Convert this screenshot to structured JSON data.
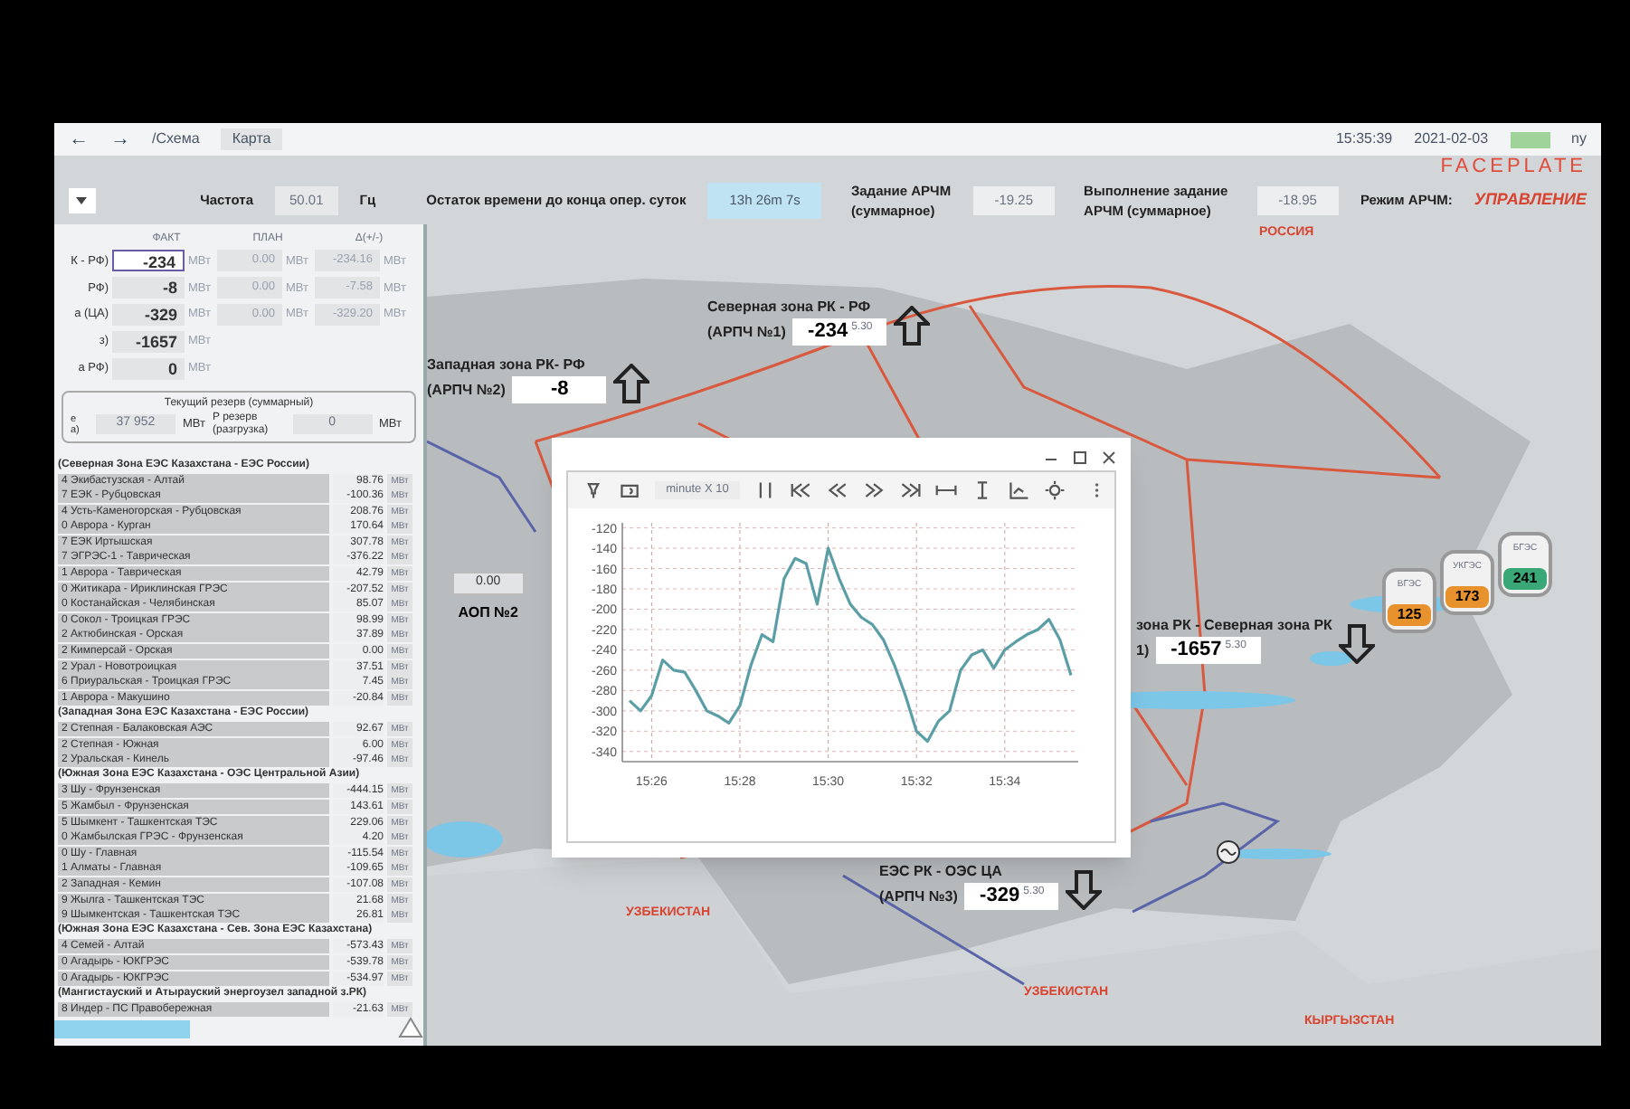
{
  "nav": {
    "back": "←",
    "forward": "→",
    "path": "/Схема",
    "tab": "Карта",
    "time": "15:35:39",
    "date": "2021-02-03",
    "user": "ny"
  },
  "logo": "FACEPLATE",
  "params": {
    "freq_label": "Частота",
    "freq": "50.01",
    "freq_unit": "Гц",
    "remain_label": "Остаток времени до конца опер. суток",
    "remain": "13h 26m 7s",
    "task_label": "Задание АРЧМ (суммарное)",
    "task": "-19.25",
    "exec_label": "Выполнение задание АРЧМ (суммарное)",
    "exec": "-18.95",
    "mode_label": "Режим АРЧМ:",
    "mode": "УПРАВЛЕНИЕ"
  },
  "summary": {
    "columns": [
      "ФАКТ",
      "ПЛАН",
      "Δ(+/-)"
    ],
    "rows": [
      {
        "label": "К - РФ)",
        "fact": "-234",
        "unit": "МВт",
        "plan": "0.00",
        "plan_unit": "МВт",
        "delta": "-234.16",
        "delta_unit": "МВт",
        "selected": true
      },
      {
        "label": "РФ)",
        "fact": "-8",
        "unit": "МВт",
        "plan": "0.00",
        "plan_unit": "МВт",
        "delta": "-7.58",
        "delta_unit": "МВт",
        "selected": false
      },
      {
        "label": "а (ЦА)",
        "fact": "-329",
        "unit": "МВт",
        "plan": "0.00",
        "plan_unit": "МВт",
        "delta": "-329.20",
        "delta_unit": "МВт",
        "selected": false
      },
      {
        "label": "з)",
        "fact": "-1657",
        "unit": "МВт",
        "selected": false
      },
      {
        "label": "а РФ)",
        "fact": "0",
        "unit": "МВт",
        "selected": false
      }
    ]
  },
  "reserve": {
    "title": "Текущий резерв (суммарный)",
    "label_1": "е\nа)",
    "value_1": "37 952",
    "unit_1": "МВт",
    "label_2": "P резерв (разгрузка)",
    "value_2": "0",
    "unit_2": "МВт"
  },
  "flows": [
    {
      "kind": "header",
      "name": "(Северная Зона ЕЭС Казахстана - ЕЭС России)"
    },
    {
      "kind": "row",
      "name": "4 Экибастузская - Алтай",
      "value": "98.76",
      "unit": "МВт"
    },
    {
      "kind": "row",
      "name": "7 ЕЭК - Рубцовская",
      "value": "-100.36",
      "unit": "МВт"
    },
    {
      "kind": "row",
      "name": "4 Усть-Каменогорская - Рубцовская",
      "value": "208.76",
      "unit": "МВт"
    },
    {
      "kind": "row",
      "name": "0 Аврора - Курган",
      "value": "170.64",
      "unit": "МВт"
    },
    {
      "kind": "row",
      "name": "7 ЕЭК Иртышская",
      "value": "307.78",
      "unit": "МВт"
    },
    {
      "kind": "row",
      "name": "7 ЭГРЭС-1 - Таврическая",
      "value": "-376.22",
      "unit": "МВт"
    },
    {
      "kind": "row",
      "name": "1 Аврора - Таврическая",
      "value": "42.79",
      "unit": "МВт"
    },
    {
      "kind": "row",
      "name": "0 Житикара - Ириклинская ГРЭС",
      "value": "-207.52",
      "unit": "МВт"
    },
    {
      "kind": "row",
      "name": "0 Костанайская - Челябинская",
      "value": "85.07",
      "unit": "МВт"
    },
    {
      "kind": "row",
      "name": "0 Сокол - Троицкая ГРЭС",
      "value": "98.99",
      "unit": "МВт"
    },
    {
      "kind": "row",
      "name": "2 Актюбинская - Орская",
      "value": "37.89",
      "unit": "МВт"
    },
    {
      "kind": "row",
      "name": "2 Кимперсай - Орская",
      "value": "0.00",
      "unit": "МВт"
    },
    {
      "kind": "row",
      "name": "2 Урал - Новотроицкая",
      "value": "37.51",
      "unit": "МВт"
    },
    {
      "kind": "row",
      "name": "6 Приуральская - Троицкая ГРЭС",
      "value": "7.45",
      "unit": "МВт"
    },
    {
      "kind": "row",
      "name": "1 Аврора - Макушино",
      "value": "-20.84",
      "unit": "МВт"
    },
    {
      "kind": "header",
      "name": "(Западная Зона ЕЭС Казахстана - ЕЭС России)"
    },
    {
      "kind": "row",
      "name": "2 Степная - Балаковская АЭС",
      "value": "92.67",
      "unit": "МВт"
    },
    {
      "kind": "row",
      "name": "2 Степная - Южная",
      "value": "6.00",
      "unit": "МВт"
    },
    {
      "kind": "row",
      "name": "2 Уральская - Кинель",
      "value": "-97.46",
      "unit": "МВт"
    },
    {
      "kind": "header",
      "name": "(Южная Зона ЕЭС Казахстана - ОЭС Центральной Азии)"
    },
    {
      "kind": "row",
      "name": "3 Шу - Фрунзенская",
      "value": "-444.15",
      "unit": "МВт"
    },
    {
      "kind": "row",
      "name": "5 Жамбыл - Фрунзенская",
      "value": "143.61",
      "unit": "МВт"
    },
    {
      "kind": "row",
      "name": "5 Шымкент - Ташкентская ТЭС",
      "value": "229.06",
      "unit": "МВт"
    },
    {
      "kind": "row",
      "name": "0 Жамбылская ГРЭС - Фрунзенская",
      "value": "4.20",
      "unit": "МВт"
    },
    {
      "kind": "row",
      "name": "0 Шу - Главная",
      "value": "-115.54",
      "unit": "МВт"
    },
    {
      "kind": "row",
      "name": "1 Алматы - Главная",
      "value": "-109.65",
      "unit": "МВт"
    },
    {
      "kind": "row",
      "name": "2 Западная - Кемин",
      "value": "-107.08",
      "unit": "МВт"
    },
    {
      "kind": "row",
      "name": "9 Жылга - Ташкентская ТЭС",
      "value": "21.68",
      "unit": "МВт"
    },
    {
      "kind": "row",
      "name": "9 Шымкентская - Ташкентская ТЭС",
      "value": "26.81",
      "unit": "МВт"
    },
    {
      "kind": "header",
      "name": "(Южная Зона ЕЭС Казахстана - Сев. Зона ЕЭС Казахстана)"
    },
    {
      "kind": "row",
      "name": "4 Семей - Алтай",
      "value": "-573.43",
      "unit": "МВт"
    },
    {
      "kind": "row",
      "name": "0 Агадырь - ЮКГРЭС",
      "value": "-539.78",
      "unit": "МВт"
    },
    {
      "kind": "row",
      "name": "0 Агадырь - ЮКГРЭС",
      "value": "-534.97",
      "unit": "МВт"
    },
    {
      "kind": "header",
      "name": "(Мангистауский и Атырауский энергоузел западной з.РК)"
    },
    {
      "kind": "row",
      "name": "8 Индер - ПС Правобережная",
      "value": "-21.63",
      "unit": "МВт"
    }
  ],
  "map": {
    "countries": [
      {
        "name": "РОССИЯ"
      },
      {
        "name": "УЗБЕКИСТАН"
      },
      {
        "name": "УЗБЕКИСТАН"
      },
      {
        "name": "КЫРГЫЗСТАН"
      }
    ],
    "zones": [
      {
        "title": "Северная зона РК - РФ",
        "sub": "(АРПЧ №1)",
        "value": "-234",
        "sup": "5.30",
        "arrow_up": true
      },
      {
        "title": "Западная зона РК- РФ",
        "sub": "(АРПЧ №2)",
        "value": "-8",
        "arrow_up": true
      },
      {
        "title": "зона РК - Северная зона РК",
        "sub": "1)",
        "value": "-1657",
        "sup": "5.30",
        "arrow_up": false
      },
      {
        "title": "ЕЭС РК - ОЭС ЦА",
        "sub": "(АРПЧ №3)",
        "value": "-329",
        "sup": "5.30",
        "arrow_up": false
      }
    ],
    "aop": {
      "value": "0.00",
      "label": "АОП №2"
    },
    "stations": [
      {
        "name": "ВГЭС",
        "value": "125",
        "color": "#e8922e"
      },
      {
        "name": "УКГЭС",
        "value": "173",
        "color": "#e8922e"
      },
      {
        "name": "БГЭС",
        "value": "241",
        "color": "#3aa876"
      }
    ]
  },
  "chart_window": {
    "scale": "minute X 10",
    "chart_data": {
      "type": "line",
      "categories": [
        null,
        null,
        "15:26",
        null,
        null,
        null,
        null,
        null,
        null,
        null,
        "15:28",
        null,
        null,
        null,
        null,
        null,
        null,
        null,
        "15:30",
        null,
        null,
        null,
        null,
        null,
        null,
        null,
        "15:32",
        null,
        null,
        null,
        null,
        null,
        null,
        null,
        "15:34",
        null,
        null,
        null,
        null,
        null,
        null
      ],
      "series": [
        {
          "color": "#5b9ea6",
          "values": [
            -290,
            -300,
            -285,
            -250,
            -260,
            -262,
            -280,
            -300,
            -305,
            -312,
            -295,
            -255,
            -225,
            -232,
            -170,
            -150,
            -155,
            -195,
            -140,
            -170,
            -195,
            -208,
            -215,
            -230,
            -255,
            -285,
            -320,
            -330,
            -310,
            -300,
            -260,
            -245,
            -240,
            -258,
            -240,
            -232,
            -225,
            -220,
            -210,
            -230,
            -265
          ]
        }
      ],
      "ylim": [
        -350,
        -115
      ],
      "grid": true,
      "yticks": [
        -120,
        -140,
        -160,
        -180,
        -200,
        -220,
        -240,
        -260,
        -280,
        -300,
        -320,
        -340
      ]
    }
  }
}
